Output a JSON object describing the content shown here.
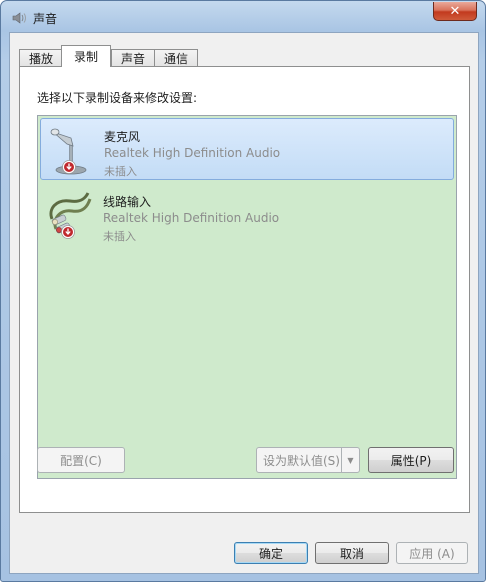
{
  "window": {
    "title": "声音",
    "close_glyph": "✕"
  },
  "tabs": [
    {
      "label": "播放",
      "active": false
    },
    {
      "label": "录制",
      "active": true
    },
    {
      "label": "声音",
      "active": false
    },
    {
      "label": "通信",
      "active": false
    }
  ],
  "instruction": "选择以下录制设备来修改设置:",
  "devices": [
    {
      "name": "麦克风",
      "driver": "Realtek High Definition Audio",
      "status": "未插入",
      "selected": true,
      "icon": "microphone-icon"
    },
    {
      "name": "线路输入",
      "driver": "Realtek High Definition Audio",
      "status": "未插入",
      "selected": false,
      "icon": "line-in-cable-icon"
    }
  ],
  "buttons": {
    "configure": "配置(C)",
    "set_default": "设为默认值(S)",
    "properties": "属性(P)",
    "ok": "确定",
    "cancel": "取消",
    "apply": "应用 (A)"
  },
  "colors": {
    "device_list_bg": "#cfeacc",
    "selected_item": "#c3dcf6",
    "status_badge": "#c0282d"
  }
}
